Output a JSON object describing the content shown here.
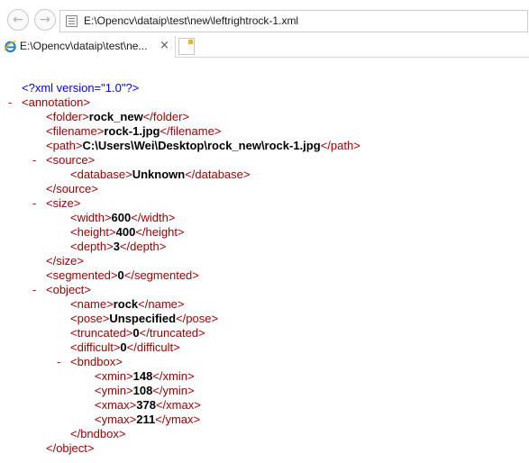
{
  "nav": {
    "back_glyph": "←",
    "forward_glyph": "→"
  },
  "address_bar": {
    "url": "E:\\Opencv\\dataip\\test\\new\\leftrightrock-1.xml",
    "icon": "page-icon"
  },
  "tab": {
    "title": "E:\\Opencv\\dataip\\test\\ne...",
    "close_glyph": "×",
    "icon": "internet-explorer-icon"
  },
  "new_tab": {
    "icon": "new-tab-icon"
  },
  "collapse_glyph": "-",
  "xml": {
    "declaration": "<?xml version=\"1.0\"?>",
    "annotation_open": "<annotation>",
    "folder_open": "<folder>",
    "folder_value": "rock_new",
    "folder_close": "</folder>",
    "filename_open": "<filename>",
    "filename_value": "rock-1.jpg",
    "filename_close": "</filename>",
    "path_open": "<path>",
    "path_value": "C:\\Users\\Wei\\Desktop\\rock_new\\rock-1.jpg",
    "path_close": "</path>",
    "source_open": "<source>",
    "database_open": "<database>",
    "database_value": "Unknown",
    "database_close": "</database>",
    "source_close": "</source>",
    "size_open": "<size>",
    "width_open": "<width>",
    "width_value": "600",
    "width_close": "</width>",
    "height_open": "<height>",
    "height_value": "400",
    "height_close": "</height>",
    "depth_open": "<depth>",
    "depth_value": "3",
    "depth_close": "</depth>",
    "size_close": "</size>",
    "segmented_open": "<segmented>",
    "segmented_value": "0",
    "segmented_close": "</segmented>",
    "object_open": "<object>",
    "name_open": "<name>",
    "name_value": "rock",
    "name_close": "</name>",
    "pose_open": "<pose>",
    "pose_value": "Unspecified",
    "pose_close": "</pose>",
    "truncated_open": "<truncated>",
    "truncated_value": "0",
    "truncated_close": "</truncated>",
    "difficult_open": "<difficult>",
    "difficult_value": "0",
    "difficult_close": "</difficult>",
    "bndbox_open": "<bndbox>",
    "xmin_open": "<xmin>",
    "xmin_value": "148",
    "xmin_close": "</xmin>",
    "ymin_open": "<ymin>",
    "ymin_value": "108",
    "ymin_close": "</ymin>",
    "xmax_open": "<xmax>",
    "xmax_value": "378",
    "xmax_close": "</xmax>",
    "ymax_open": "<ymax>",
    "ymax_value": "211",
    "ymax_close": "</ymax>",
    "bndbox_close": "</bndbox>",
    "object_close": "</object>"
  }
}
